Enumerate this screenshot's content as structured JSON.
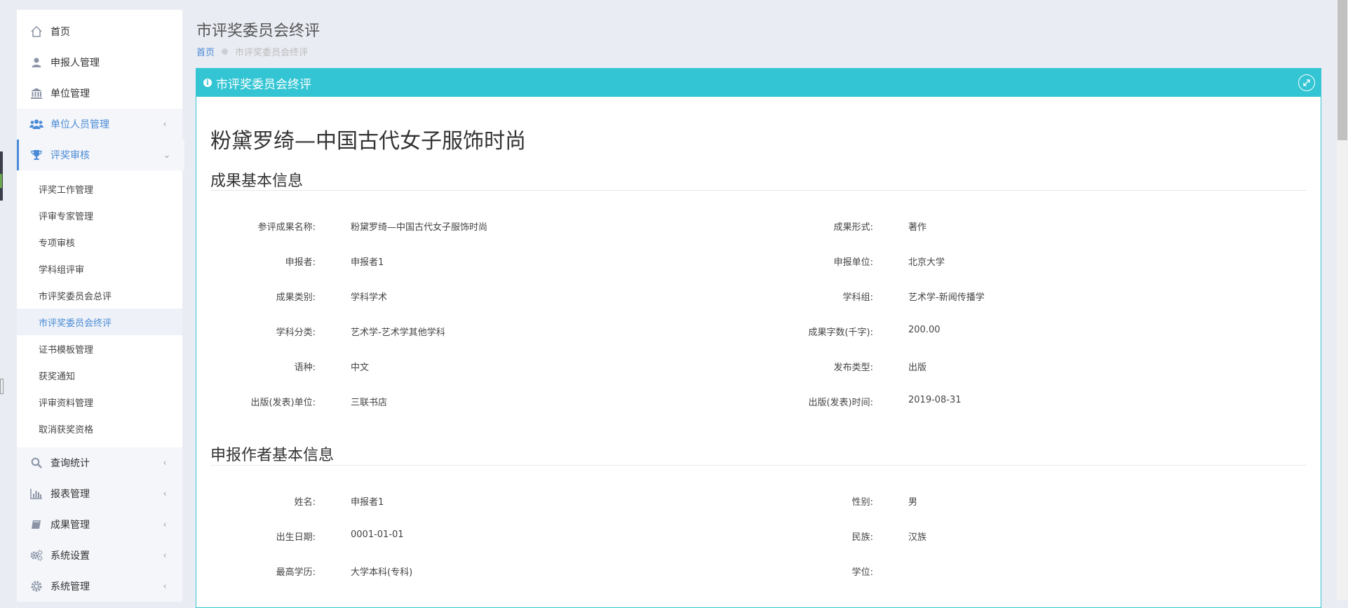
{
  "sidebar": {
    "items": [
      {
        "label": "首页",
        "icon": "home-icon"
      },
      {
        "label": "申报人管理",
        "icon": "user-icon"
      },
      {
        "label": "单位管理",
        "icon": "bank-icon"
      },
      {
        "label": "单位人员管理",
        "icon": "users-icon"
      },
      {
        "label": "评奖审核",
        "icon": "trophy-icon"
      }
    ],
    "subitems": [
      "评奖工作管理",
      "评审专家管理",
      "专项审核",
      "学科组评审",
      "市评奖委员会总评",
      "市评奖委员会终评",
      "证书模板管理",
      "获奖通知",
      "评审资料管理",
      "取消获奖资格"
    ],
    "bottom_items": [
      {
        "label": "查询统计",
        "icon": "search-icon"
      },
      {
        "label": "报表管理",
        "icon": "bar-chart-icon"
      },
      {
        "label": "成果管理",
        "icon": "book-icon"
      },
      {
        "label": "系统设置",
        "icon": "cogs-icon"
      },
      {
        "label": "系统管理",
        "icon": "gear-icon"
      }
    ]
  },
  "page": {
    "title": "市评奖委员会终评",
    "breadcrumb_home": "首页",
    "breadcrumb_current": "市评奖委员会终评"
  },
  "panel": {
    "header": "市评奖委员会终评",
    "book_title": "粉黛罗绮—中国古代女子服饰时尚",
    "section1_title": "成果基本信息",
    "section2_title": "申报作者基本信息"
  },
  "basic_info": [
    {
      "l1": "参评成果名称:",
      "v1": "粉黛罗绮—中国古代女子服饰时尚",
      "l2": "成果形式:",
      "v2": "著作"
    },
    {
      "l1": "申报者:",
      "v1": "申报者1",
      "l2": "申报单位:",
      "v2": "北京大学"
    },
    {
      "l1": "成果类别:",
      "v1": "学科学术",
      "l2": "学科组:",
      "v2": "艺术学-新闻传播学"
    },
    {
      "l1": "学科分类:",
      "v1": "艺术学-艺术学其他学科",
      "l2": "成果字数(千字):",
      "v2": "200.00"
    },
    {
      "l1": "语种:",
      "v1": "中文",
      "l2": "发布类型:",
      "v2": "出版"
    },
    {
      "l1": "出版(发表)单位:",
      "v1": "三联书店",
      "l2": "出版(发表)时间:",
      "v2": "2019-08-31"
    }
  ],
  "author_info": [
    {
      "l1": "姓名:",
      "v1": "申报者1",
      "l2": "性别:",
      "v2": "男"
    },
    {
      "l1": "出生日期:",
      "v1": "0001-01-01",
      "l2": "民族:",
      "v2": "汉族"
    },
    {
      "l1": "最高学历:",
      "v1": "大学本科(专科)",
      "l2": "学位:",
      "v2": ""
    }
  ],
  "colors": {
    "accent": "#33c5d3",
    "link": "#4a8ad6",
    "background": "#e9ecf3"
  }
}
